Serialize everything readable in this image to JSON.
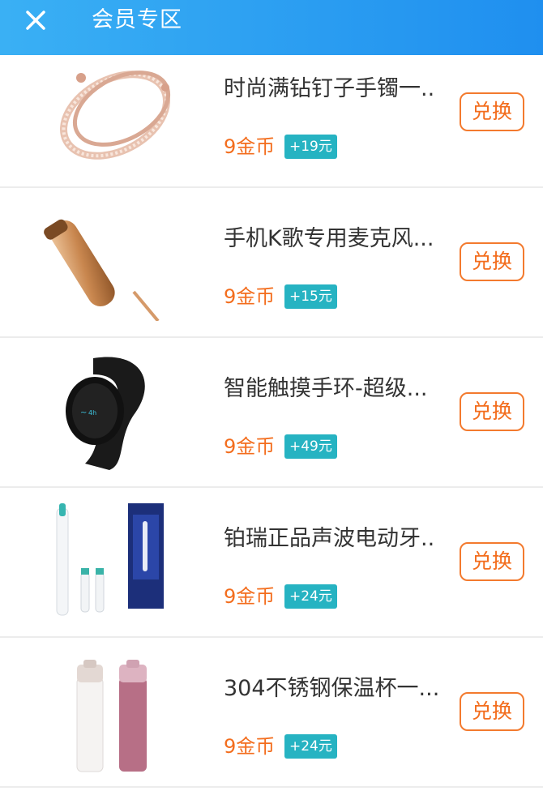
{
  "header": {
    "title": "会员专区",
    "close_icon": "close-icon"
  },
  "colors": {
    "header_start": "#3ab0f4",
    "header_end": "#1f8fef",
    "price": "#f36d1d",
    "tag_bg": "#26b3c2",
    "button_border": "#f37a2e"
  },
  "products": [
    {
      "name": "时尚满钻钉子手镯一..",
      "price": "9金币",
      "tag": "+19元",
      "button": "兑换",
      "image": "bangle-bracelet-image"
    },
    {
      "name": "手机K歌专用麦克风...",
      "price": "9金币",
      "tag": "+15元",
      "button": "兑换",
      "image": "microphone-image"
    },
    {
      "name": "智能触摸手环-超级...",
      "price": "9金币",
      "tag": "+49元",
      "button": "兑换",
      "image": "smart-band-image"
    },
    {
      "name": "铂瑞正品声波电动牙..",
      "price": "9金币",
      "tag": "+24元",
      "button": "兑换",
      "image": "electric-toothbrush-image"
    },
    {
      "name": "304不锈钢保温杯一...",
      "price": "9金币",
      "tag": "+24元",
      "button": "兑换",
      "image": "thermos-cups-image"
    }
  ]
}
